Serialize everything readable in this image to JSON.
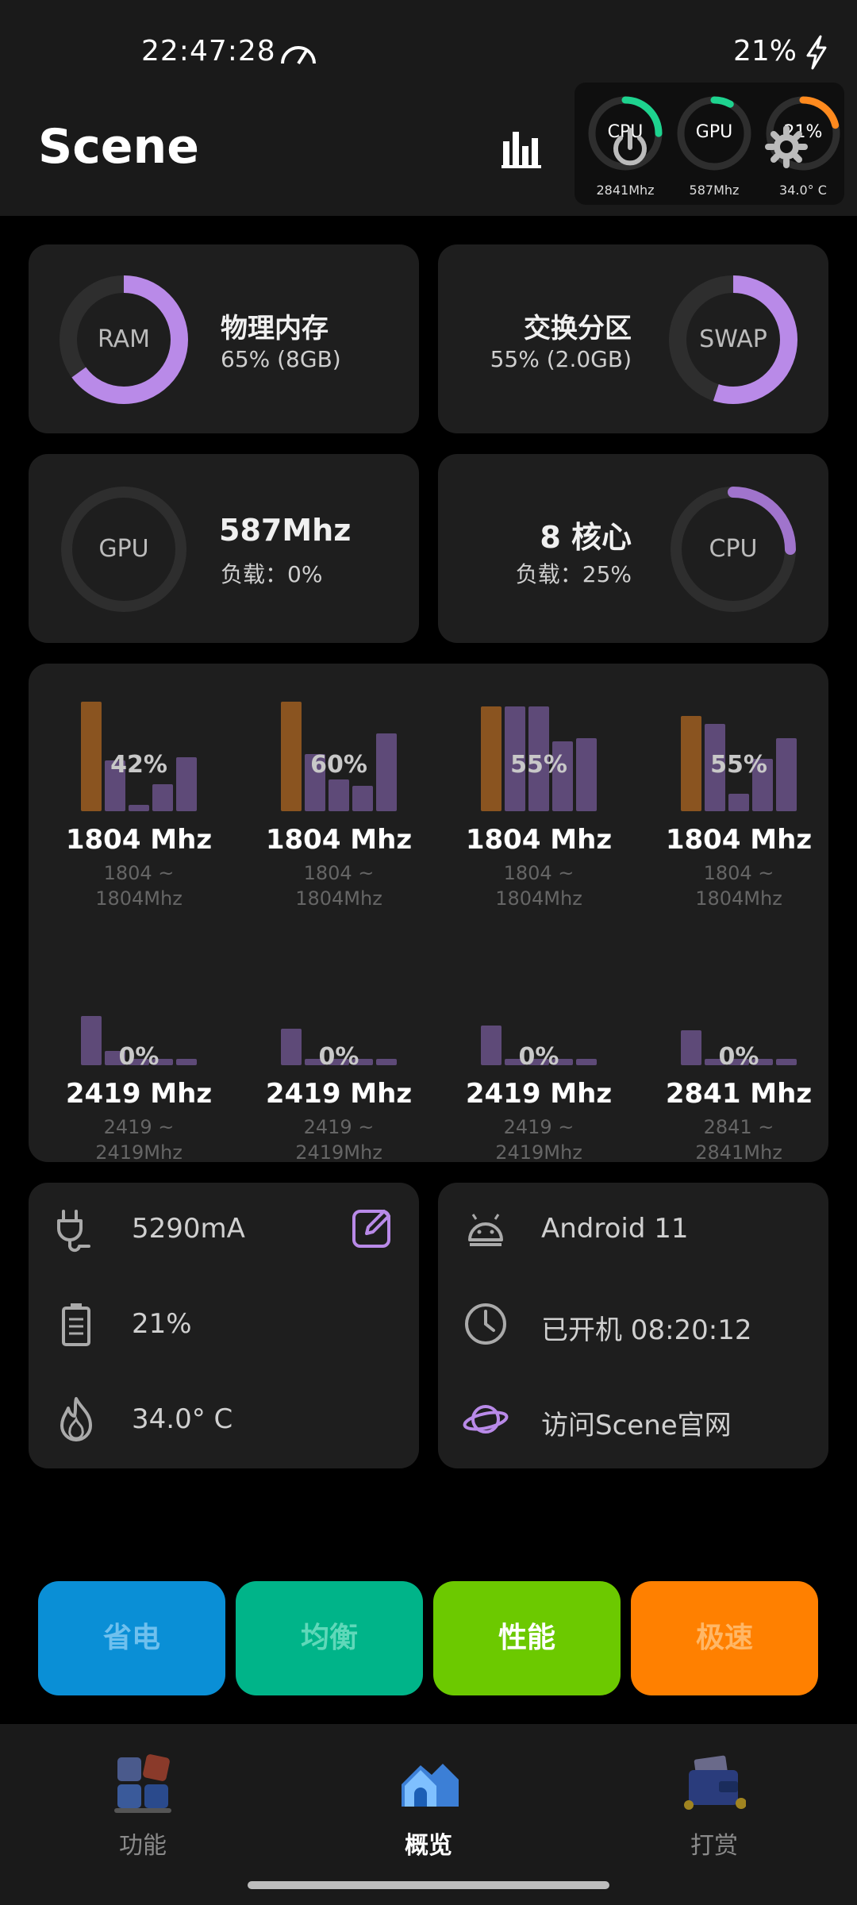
{
  "status_bar": {
    "time": "22:47:28",
    "battery": "21%"
  },
  "app_bar": {
    "title": "Scene",
    "gauges": [
      {
        "label": "CPU",
        "value": "2841Mhz",
        "level": 0.25,
        "color": "#1ed38f"
      },
      {
        "label": "GPU",
        "value": "587Mhz",
        "level": 0.08,
        "color": "#1ed38f"
      },
      {
        "label": "21%",
        "value": "34.0° C",
        "level": 0.21,
        "color": "#ff8a1e"
      }
    ]
  },
  "memory": {
    "ram": {
      "ring_label": "RAM",
      "title": "物理内存",
      "detail": "65% (8GB)",
      "level": 0.65
    },
    "swap": {
      "ring_label": "SWAP",
      "title": "交换分区",
      "detail": "55% (2.0GB)",
      "level": 0.55
    }
  },
  "gpu_card": {
    "ring_label": "GPU",
    "title": "587Mhz",
    "detail": "负载：0%",
    "level": 0.0
  },
  "cpu_card": {
    "ring_label": "CPU",
    "title": "8 核心",
    "detail": "负载：25%",
    "level": 0.25
  },
  "cores": [
    {
      "load": "42%",
      "freq": "1804 Mhz",
      "range_min": "1804 ~",
      "range_max": "1804Mhz"
    },
    {
      "load": "60%",
      "freq": "1804 Mhz",
      "range_min": "1804 ~",
      "range_max": "1804Mhz"
    },
    {
      "load": "55%",
      "freq": "1804 Mhz",
      "range_min": "1804 ~",
      "range_max": "1804Mhz"
    },
    {
      "load": "55%",
      "freq": "1804 Mhz",
      "range_min": "1804 ~",
      "range_max": "1804Mhz"
    },
    {
      "load": "0%",
      "freq": "2419 Mhz",
      "range_min": "2419 ~",
      "range_max": "2419Mhz"
    },
    {
      "load": "0%",
      "freq": "2419 Mhz",
      "range_min": "2419 ~",
      "range_max": "2419Mhz"
    },
    {
      "load": "0%",
      "freq": "2419 Mhz",
      "range_min": "2419 ~",
      "range_max": "2419Mhz"
    },
    {
      "load": "0%",
      "freq": "2841 Mhz",
      "range_min": "2841 ~",
      "range_max": "2841Mhz"
    }
  ],
  "battery_info": {
    "current": "5290mA",
    "level": "21%",
    "temperature": "34.0° C"
  },
  "system_info": {
    "android": "Android 11",
    "uptime": "已开机  08:20:12",
    "website": "访问Scene官网"
  },
  "modes": [
    {
      "label": "省电",
      "bg": "#0a8fd6",
      "fg": "#6fc0ee"
    },
    {
      "label": "均衡",
      "bg": "#00b489",
      "fg": "#5fd8b9"
    },
    {
      "label": "性能",
      "bg": "#6cc900",
      "fg": "#ffffff"
    },
    {
      "label": "极速",
      "bg": "#ff8000",
      "fg": "#ffb766"
    }
  ],
  "nav": {
    "features": "功能",
    "overview": "概览",
    "reward": "打赏"
  },
  "colors": {
    "accent_purple": "#b98ae8",
    "background": "#000000",
    "card": "#1e1e1e"
  }
}
